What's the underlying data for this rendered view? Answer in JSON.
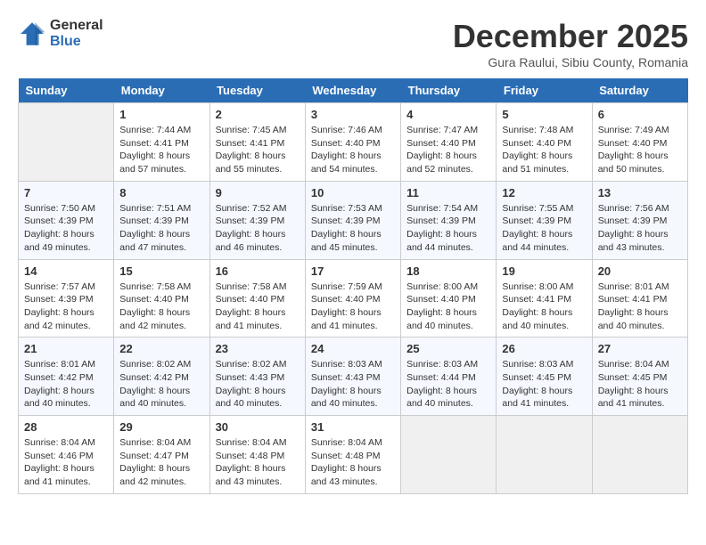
{
  "header": {
    "logo_line1": "General",
    "logo_line2": "Blue",
    "month_title": "December 2025",
    "location": "Gura Raului, Sibiu County, Romania"
  },
  "days_of_week": [
    "Sunday",
    "Monday",
    "Tuesday",
    "Wednesday",
    "Thursday",
    "Friday",
    "Saturday"
  ],
  "weeks": [
    [
      {
        "day": "",
        "info": ""
      },
      {
        "day": "1",
        "info": "Sunrise: 7:44 AM\nSunset: 4:41 PM\nDaylight: 8 hours\nand 57 minutes."
      },
      {
        "day": "2",
        "info": "Sunrise: 7:45 AM\nSunset: 4:41 PM\nDaylight: 8 hours\nand 55 minutes."
      },
      {
        "day": "3",
        "info": "Sunrise: 7:46 AM\nSunset: 4:40 PM\nDaylight: 8 hours\nand 54 minutes."
      },
      {
        "day": "4",
        "info": "Sunrise: 7:47 AM\nSunset: 4:40 PM\nDaylight: 8 hours\nand 52 minutes."
      },
      {
        "day": "5",
        "info": "Sunrise: 7:48 AM\nSunset: 4:40 PM\nDaylight: 8 hours\nand 51 minutes."
      },
      {
        "day": "6",
        "info": "Sunrise: 7:49 AM\nSunset: 4:40 PM\nDaylight: 8 hours\nand 50 minutes."
      }
    ],
    [
      {
        "day": "7",
        "info": "Sunrise: 7:50 AM\nSunset: 4:39 PM\nDaylight: 8 hours\nand 49 minutes."
      },
      {
        "day": "8",
        "info": "Sunrise: 7:51 AM\nSunset: 4:39 PM\nDaylight: 8 hours\nand 47 minutes."
      },
      {
        "day": "9",
        "info": "Sunrise: 7:52 AM\nSunset: 4:39 PM\nDaylight: 8 hours\nand 46 minutes."
      },
      {
        "day": "10",
        "info": "Sunrise: 7:53 AM\nSunset: 4:39 PM\nDaylight: 8 hours\nand 45 minutes."
      },
      {
        "day": "11",
        "info": "Sunrise: 7:54 AM\nSunset: 4:39 PM\nDaylight: 8 hours\nand 44 minutes."
      },
      {
        "day": "12",
        "info": "Sunrise: 7:55 AM\nSunset: 4:39 PM\nDaylight: 8 hours\nand 44 minutes."
      },
      {
        "day": "13",
        "info": "Sunrise: 7:56 AM\nSunset: 4:39 PM\nDaylight: 8 hours\nand 43 minutes."
      }
    ],
    [
      {
        "day": "14",
        "info": "Sunrise: 7:57 AM\nSunset: 4:39 PM\nDaylight: 8 hours\nand 42 minutes."
      },
      {
        "day": "15",
        "info": "Sunrise: 7:58 AM\nSunset: 4:40 PM\nDaylight: 8 hours\nand 42 minutes."
      },
      {
        "day": "16",
        "info": "Sunrise: 7:58 AM\nSunset: 4:40 PM\nDaylight: 8 hours\nand 41 minutes."
      },
      {
        "day": "17",
        "info": "Sunrise: 7:59 AM\nSunset: 4:40 PM\nDaylight: 8 hours\nand 41 minutes."
      },
      {
        "day": "18",
        "info": "Sunrise: 8:00 AM\nSunset: 4:40 PM\nDaylight: 8 hours\nand 40 minutes."
      },
      {
        "day": "19",
        "info": "Sunrise: 8:00 AM\nSunset: 4:41 PM\nDaylight: 8 hours\nand 40 minutes."
      },
      {
        "day": "20",
        "info": "Sunrise: 8:01 AM\nSunset: 4:41 PM\nDaylight: 8 hours\nand 40 minutes."
      }
    ],
    [
      {
        "day": "21",
        "info": "Sunrise: 8:01 AM\nSunset: 4:42 PM\nDaylight: 8 hours\nand 40 minutes."
      },
      {
        "day": "22",
        "info": "Sunrise: 8:02 AM\nSunset: 4:42 PM\nDaylight: 8 hours\nand 40 minutes."
      },
      {
        "day": "23",
        "info": "Sunrise: 8:02 AM\nSunset: 4:43 PM\nDaylight: 8 hours\nand 40 minutes."
      },
      {
        "day": "24",
        "info": "Sunrise: 8:03 AM\nSunset: 4:43 PM\nDaylight: 8 hours\nand 40 minutes."
      },
      {
        "day": "25",
        "info": "Sunrise: 8:03 AM\nSunset: 4:44 PM\nDaylight: 8 hours\nand 40 minutes."
      },
      {
        "day": "26",
        "info": "Sunrise: 8:03 AM\nSunset: 4:45 PM\nDaylight: 8 hours\nand 41 minutes."
      },
      {
        "day": "27",
        "info": "Sunrise: 8:04 AM\nSunset: 4:45 PM\nDaylight: 8 hours\nand 41 minutes."
      }
    ],
    [
      {
        "day": "28",
        "info": "Sunrise: 8:04 AM\nSunset: 4:46 PM\nDaylight: 8 hours\nand 41 minutes."
      },
      {
        "day": "29",
        "info": "Sunrise: 8:04 AM\nSunset: 4:47 PM\nDaylight: 8 hours\nand 42 minutes."
      },
      {
        "day": "30",
        "info": "Sunrise: 8:04 AM\nSunset: 4:48 PM\nDaylight: 8 hours\nand 43 minutes."
      },
      {
        "day": "31",
        "info": "Sunrise: 8:04 AM\nSunset: 4:48 PM\nDaylight: 8 hours\nand 43 minutes."
      },
      {
        "day": "",
        "info": ""
      },
      {
        "day": "",
        "info": ""
      },
      {
        "day": "",
        "info": ""
      }
    ]
  ]
}
